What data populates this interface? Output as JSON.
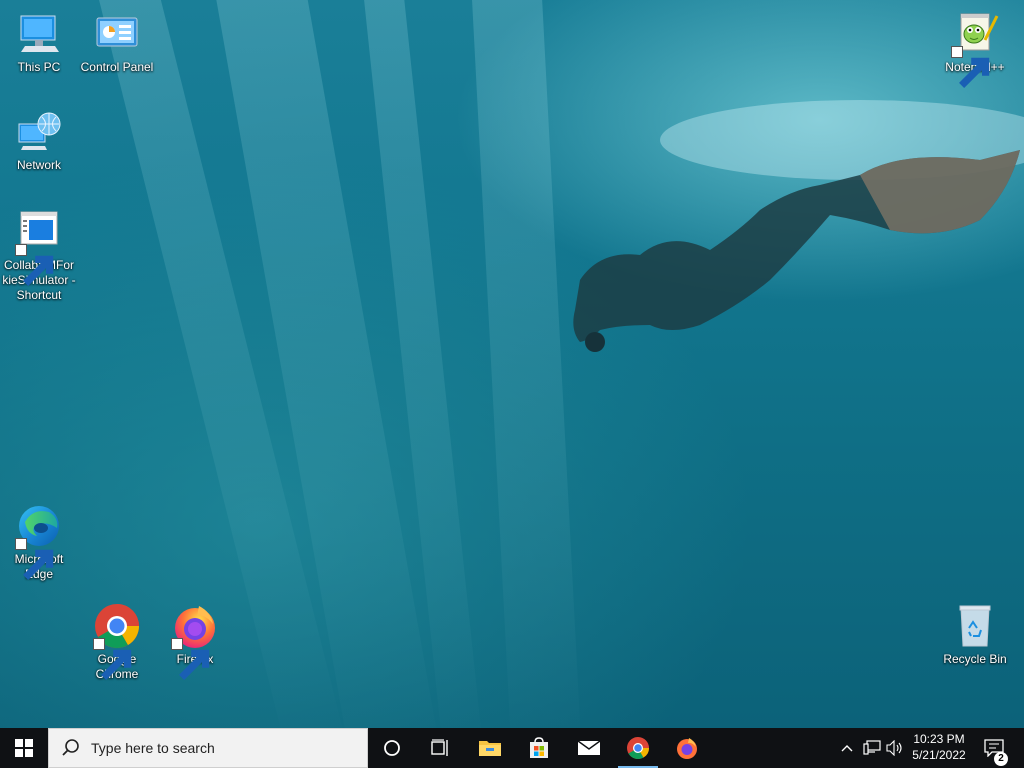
{
  "desktop": {
    "icons": {
      "this_pc": "This PC",
      "control_panel": "Control Panel",
      "network": "Network",
      "collab": "CollabVMFor kieSimulator - Shortcut",
      "edge": "Microsoft Edge",
      "chrome": "Google Chrome",
      "firefox": "Firefox",
      "notepadpp": "Notepad++",
      "recycle_bin": "Recycle Bin"
    }
  },
  "taskbar": {
    "search_placeholder": "Type here to search",
    "clock": {
      "time": "10:23 PM",
      "date": "5/21/2022"
    },
    "notification_count": "2",
    "pinned": [
      "cortana-icon",
      "task-view-icon",
      "file-explorer-icon",
      "microsoft-store-icon",
      "mail-icon",
      "chrome-icon",
      "firefox-icon"
    ]
  },
  "colors": {
    "taskbar_bg": "#0f1114",
    "search_bg": "#f2f2f2",
    "active_indicator": "#76b9ed",
    "wallpaper_water": "#137891"
  }
}
